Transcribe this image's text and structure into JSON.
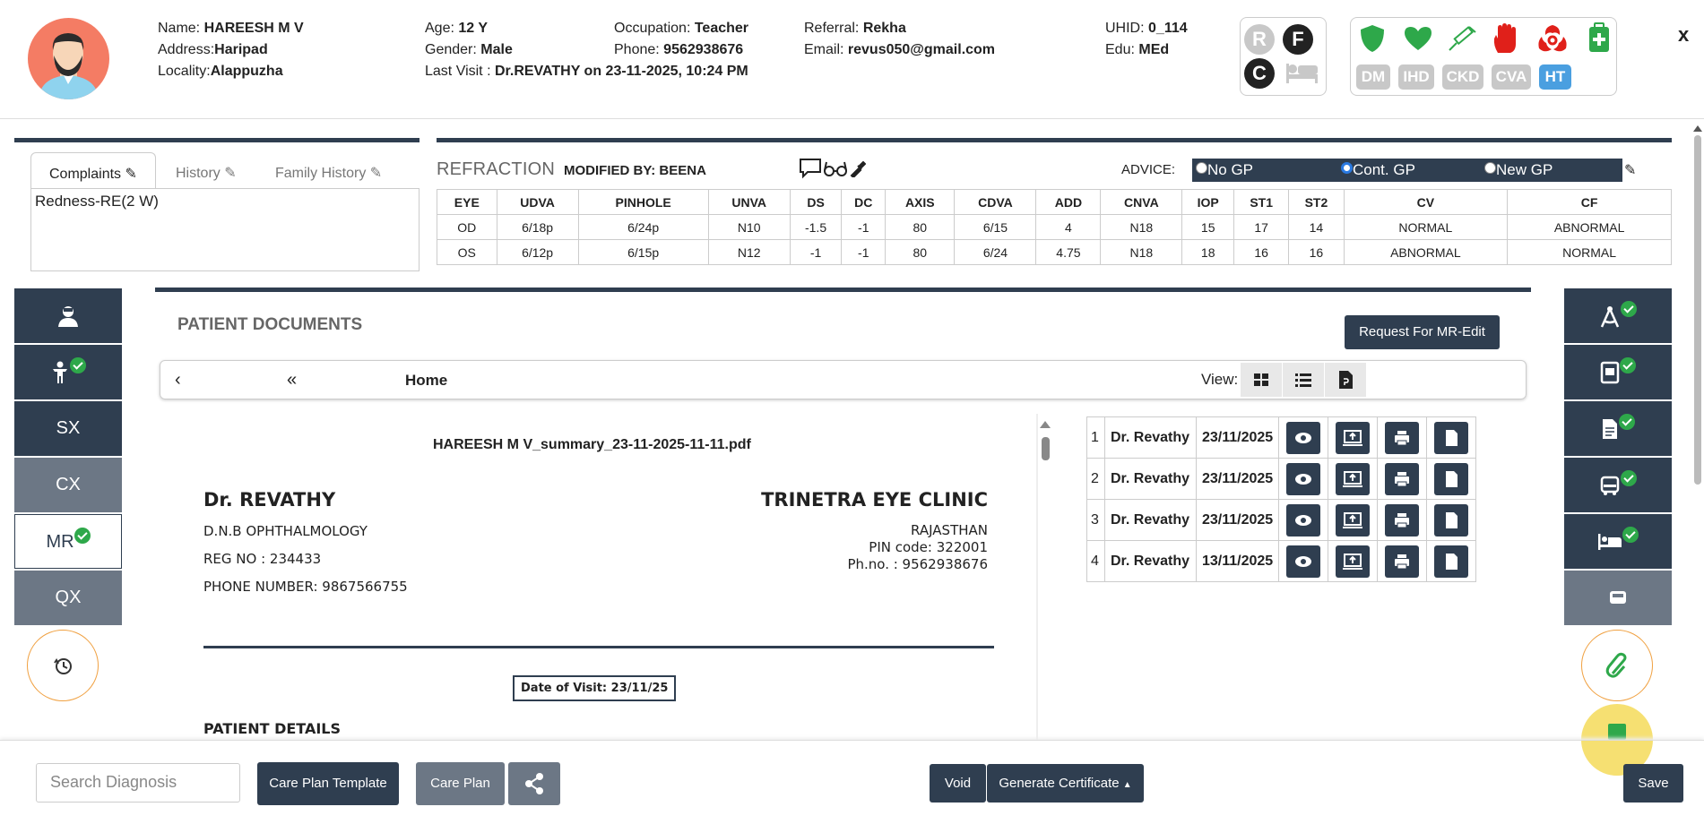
{
  "patient": {
    "name_label": "Name:",
    "name": "HAREESH M V",
    "address_label": "Address:",
    "address": "Haripad",
    "locality_label": "Locality:",
    "locality": "Alappuzha",
    "age_label": "Age:",
    "age": "12 Y",
    "gender_label": "Gender:",
    "gender": "Male",
    "last_visit_label": "Last Visit :",
    "last_visit": "Dr.REVATHY on  23-11-2025, 10:24 PM",
    "occupation_label": "Occupation:",
    "occupation": "Teacher",
    "phone_label": "Phone:",
    "phone": "9562938676",
    "referral_label": "Referral:",
    "referral": "Rekha",
    "email_label": "Email:",
    "email": "revus050@gmail.com",
    "uhid_label": "UHID:",
    "uhid": "0_114",
    "edu_label": "Edu:",
    "edu": "MEd"
  },
  "badges": {
    "r": "R",
    "f": "F",
    "c": "C"
  },
  "conditions": [
    "DM",
    "IHD",
    "CKD",
    "CVA",
    "HT"
  ],
  "close": "x",
  "complaints": {
    "tabs": [
      "Complaints",
      "History",
      "Family History"
    ],
    "text": "Redness-RE(2 W)"
  },
  "refraction": {
    "title": "REFRACTION",
    "modified_label": "MODIFIED BY:",
    "modified_by": "BEENA",
    "advice_label": "ADVICE:",
    "advice_options": [
      "No GP",
      "Cont. GP",
      "New GP"
    ],
    "advice_selected": "Cont. GP",
    "headers": [
      "EYE",
      "UDVA",
      "PINHOLE",
      "UNVA",
      "DS",
      "DC",
      "AXIS",
      "CDVA",
      "ADD",
      "CNVA",
      "IOP",
      "ST1",
      "ST2",
      "CV",
      "CF"
    ],
    "rows": [
      [
        "OD",
        "6/18p",
        "6/24p",
        "N10",
        "-1.5",
        "-1",
        "80",
        "6/15",
        "4",
        "N18",
        "15",
        "17",
        "14",
        "NORMAL",
        "ABNORMAL"
      ],
      [
        "OS",
        "6/12p",
        "6/15p",
        "N12",
        "-1",
        "-1",
        "80",
        "6/24",
        "4.75",
        "N18",
        "18",
        "16",
        "16",
        "ABNORMAL",
        "NORMAL"
      ]
    ]
  },
  "left_nav": [
    "SX",
    "CX",
    "MR",
    "QX"
  ],
  "documents": {
    "title": "PATIENT DOCUMENTS",
    "request_btn": "Request For MR-Edit",
    "breadcrumb": "Home",
    "view_label": "View:",
    "pdf": {
      "filename": "HAREESH M V_summary_23-11-2025-11-11.pdf",
      "doctor": "Dr. REVATHY",
      "qualification": "D.N.B OPHTHALMOLOGY",
      "reg": "REG NO : 234433",
      "phone": "PHONE NUMBER: 9867566755",
      "clinic": "TRINETRA EYE CLINIC",
      "state": "RAJASTHAN",
      "pin": "PIN code: 322001",
      "clinic_phone": "Ph.no. : 9562938676",
      "visit": "Date of Visit: 23/11/25",
      "details": "PATIENT DETAILS"
    },
    "list": [
      {
        "n": "1",
        "doctor": "Dr. Revathy",
        "date": "23/11/2025"
      },
      {
        "n": "2",
        "doctor": "Dr. Revathy",
        "date": "23/11/2025"
      },
      {
        "n": "3",
        "doctor": "Dr. Revathy",
        "date": "23/11/2025"
      },
      {
        "n": "4",
        "doctor": "Dr. Revathy",
        "date": "13/11/2025"
      }
    ]
  },
  "footer": {
    "search_placeholder": "Search Diagnosis",
    "care_plan_template": "Care Plan Template",
    "care_plan": "Care Plan",
    "void": "Void",
    "generate_certificate": "Generate Certificate",
    "save": "Save"
  },
  "colors": {
    "dark": "#2f3e50",
    "grey": "#6c7785",
    "green": "#2ea84a",
    "red": "#e0201a",
    "tag_grey": "#c8c8c8",
    "tag_blue": "#4a9fe0"
  }
}
